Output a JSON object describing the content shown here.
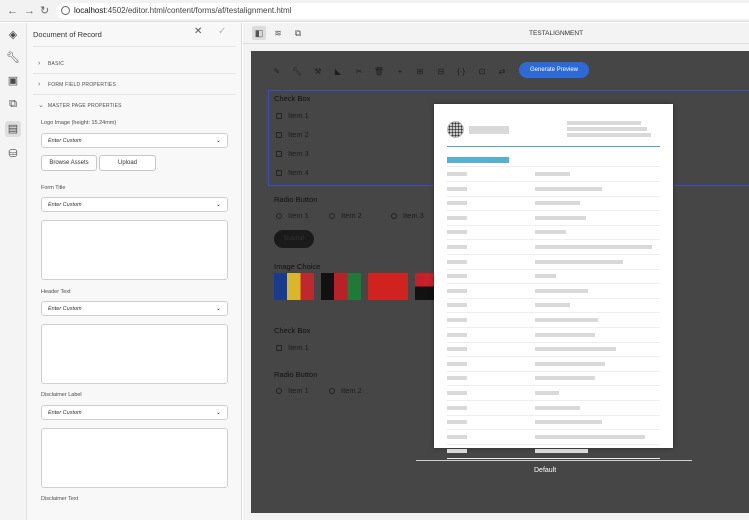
{
  "browser": {
    "url_host": "localhost",
    "url_rest": ":4502/editor.html/content/forms/af/testalignment.html"
  },
  "rail": {
    "icons": [
      "layers-icon",
      "wrench-icon",
      "assets-icon",
      "content-tree-icon",
      "document-of-record-icon",
      "data-model-icon"
    ]
  },
  "panel": {
    "title": "Document of Record",
    "sections": [
      "BASIC",
      "FORM FIELD PROPERTIES",
      "MASTER PAGE PROPERTIES"
    ],
    "logo_label": "Logo Image (height: 15.24mm)",
    "logo_value": "Enter Custom",
    "browse_label": "Browse Assets",
    "upload_label": "Upload",
    "form_title_label": "Form Title",
    "form_title_value": "Enter Custom",
    "header_text_label": "Header Text",
    "header_text_value": "Enter Custom",
    "disclaimer_label_label": "Disclaimer Label",
    "disclaimer_label_value": "Enter Custom",
    "disclaimer_text_label": "Disclaimer Text"
  },
  "topbar": {
    "title": "TESTALIGNMENT"
  },
  "canvas": {
    "generate_label": "Generate Preview",
    "checkbox1": {
      "label": "Check Box",
      "items": [
        "Item 1",
        "Item 2",
        "Item 3",
        "Item 4"
      ]
    },
    "radio1": {
      "label": "Radio Button",
      "items": [
        "Item 1",
        "Item 2",
        "Item 3"
      ]
    },
    "submit_label": "Submit",
    "image_choice_label": "Image Choice",
    "checkbox2": {
      "label": "Check Box",
      "items": [
        "Item 1"
      ]
    },
    "radio2": {
      "label": "Radio Button",
      "items": [
        "Item 1",
        "Item 2"
      ]
    },
    "preview_caption": "Default"
  },
  "colors": {
    "accent": "#2d6ad6",
    "canvas_bg": "#464646",
    "selection": "#3a4fb8",
    "preview_accent": "#55b1cf"
  }
}
